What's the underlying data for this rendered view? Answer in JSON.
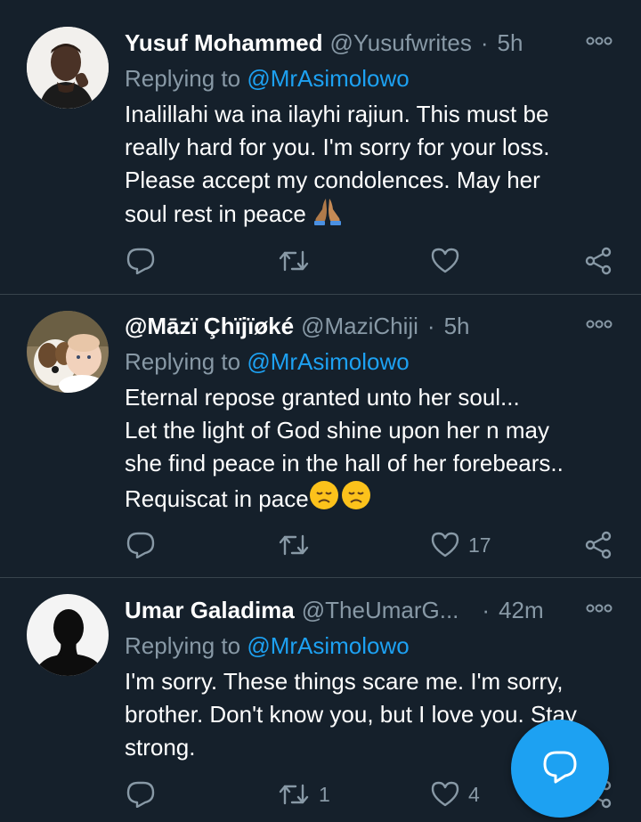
{
  "colors": {
    "background": "#15202b",
    "accent": "#1da1f2",
    "muted": "#8899a6",
    "divider": "#38444d"
  },
  "tweets": [
    {
      "name": "Yusuf Mohammed",
      "handle": "@Yusufwrites",
      "separator": "·",
      "time": "5h",
      "reply_prefix": "Replying to ",
      "reply_mention": "@MrAsimolowo",
      "body_lines": [
        "Inalillahi wa ina ilayhi rajiun. This must be",
        "really hard for you. I'm sorry for your loss.",
        "Please accept my condolences. May her",
        "soul rest in peace"
      ],
      "emoji": "folded-hands",
      "likes": "",
      "retweets": ""
    },
    {
      "name": "@Māzï Çhïjïøké",
      "handle": "@MaziChiji",
      "separator": "·",
      "time": "5h",
      "reply_prefix": "Replying to ",
      "reply_mention": "@MrAsimolowo",
      "body_lines": [
        "Eternal repose granted unto her soul...",
        "Let the light of God shine upon her n may",
        "she find peace in the hall of her forebears..",
        "Requiscat in pace"
      ],
      "emoji": "disappointed-face",
      "likes": "17",
      "retweets": ""
    },
    {
      "name": "Umar Galadima",
      "handle": "@TheUmarG...",
      "separator": "·",
      "time": "42m",
      "reply_prefix": "Replying to ",
      "reply_mention": "@MrAsimolowo",
      "body_lines": [
        "I'm sorry. These things scare me. I'm sorry,",
        "brother. Don't know you, but I love you. Stay",
        "strong."
      ],
      "emoji": "",
      "likes": "4",
      "retweets": "1"
    }
  ],
  "icons": {
    "reply": "reply-icon",
    "retweet": "retweet-icon",
    "like": "heart-icon",
    "share": "share-icon",
    "more": "more-options-icon",
    "compose": "compose-reply-icon"
  }
}
